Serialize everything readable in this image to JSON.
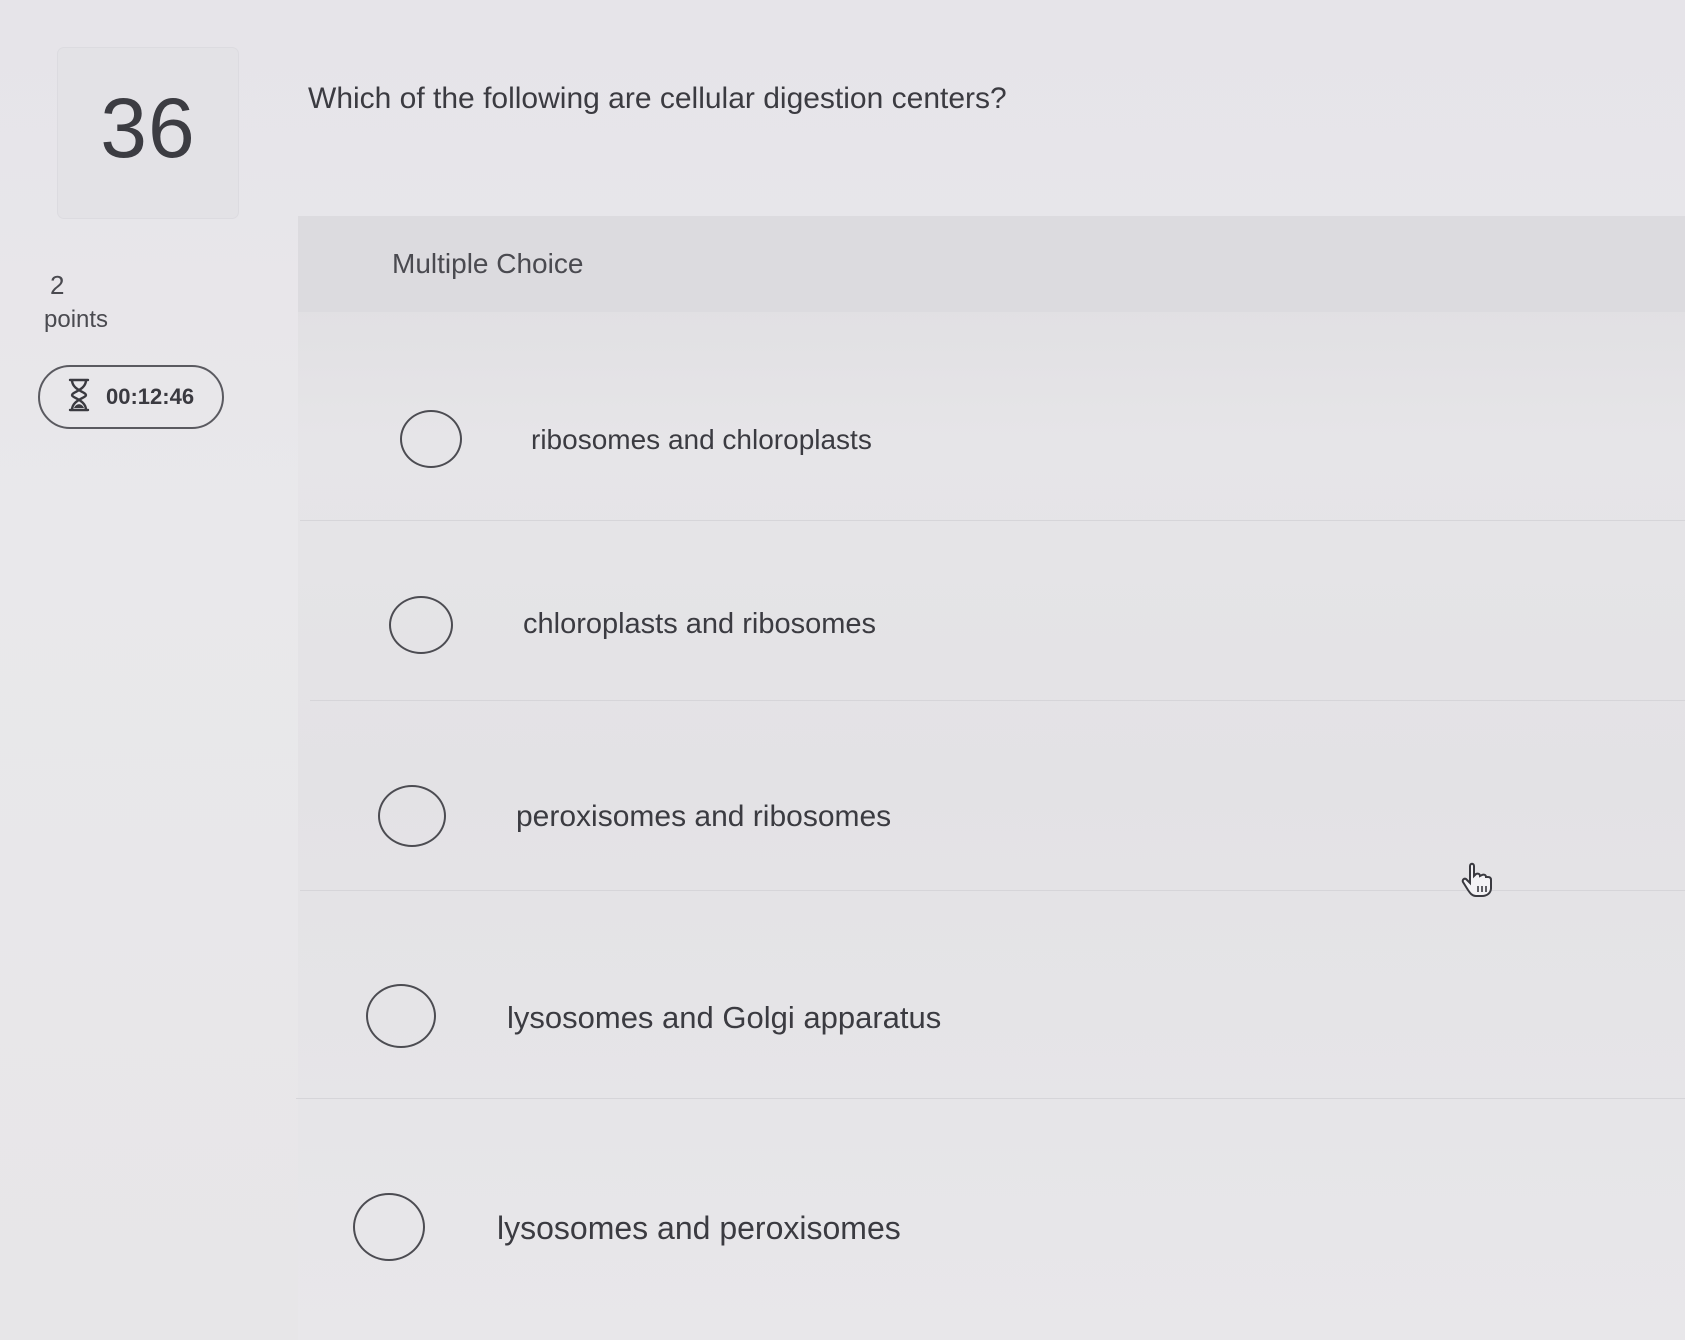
{
  "question": {
    "number": "36",
    "points_value": "2",
    "points_label": "points",
    "timer": "00:12:46",
    "text": "Which of the following are cellular digestion centers?",
    "type_label": "Multiple Choice"
  },
  "options": [
    {
      "label": "ribosomes and chloroplasts"
    },
    {
      "label": "chloroplasts and ribosomes"
    },
    {
      "label": "peroxisomes and ribosomes"
    },
    {
      "label": "lysosomes and Golgi apparatus"
    },
    {
      "label": "lysosomes and peroxisomes"
    }
  ],
  "icons": {
    "timer": "hourglass-icon",
    "cursor": "hand-pointer-icon"
  }
}
